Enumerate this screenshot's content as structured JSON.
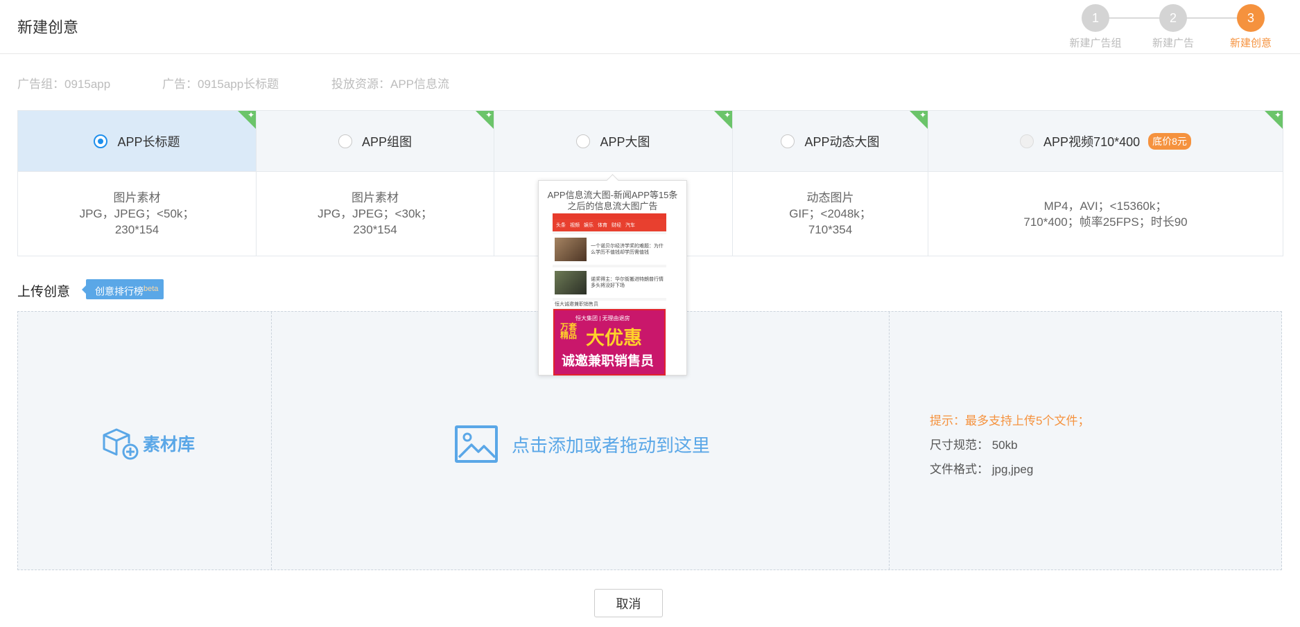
{
  "header": {
    "title": "新建创意",
    "steps": [
      {
        "num": "1",
        "label": "新建广告组"
      },
      {
        "num": "2",
        "label": "新建广告"
      },
      {
        "num": "3",
        "label": "新建创意"
      }
    ],
    "active_step": 3,
    "accent_color": "#f5923e"
  },
  "info": {
    "ad_group": "广告组：0915app",
    "ad": "广告：0915app长标题",
    "resource": "投放资源：APP信息流"
  },
  "types": [
    {
      "label": "APP长标题",
      "selected": true,
      "spec": [
        "图片素材",
        "JPG，JPEG；<50k；",
        "230*154"
      ]
    },
    {
      "label": "APP组图",
      "selected": false,
      "spec": [
        "图片素材",
        "JPG，JPEG；<30k；",
        "230*154"
      ]
    },
    {
      "label": "APP大图",
      "selected": false,
      "spec": []
    },
    {
      "label": "APP动态大图",
      "selected": false,
      "spec": [
        "动态图片",
        "GIF；<2048k；",
        "710*354"
      ]
    },
    {
      "label": "APP视频710*400",
      "selected": false,
      "badge": "底价8元",
      "spec": [
        "MP4，AVI；<15360k；",
        "710*400；帧率25FPS；时长90"
      ]
    }
  ],
  "popup": {
    "title": "APP信息流大图-新闻APP等15条之后的信息流大图广告",
    "nav_items": [
      "头条",
      "视频",
      "娱乐",
      "体育",
      "财经",
      "汽车"
    ],
    "news": [
      "一个诺贝尔经济学奖的难题：为什么学历不值钱却学历需值钱",
      "诺奖得主：华尔街搬进特朗普行情 多头将没好下场"
    ],
    "ad_label": "恒大诚邀兼职销售员",
    "ad_top": "恒大集团 | 无理由退房",
    "ad_small": "万套精品",
    "ad_big": "大优惠",
    "ad_bottom": "诚邀兼职销售员"
  },
  "upload": {
    "section_title": "上传创意",
    "ranking_label": "创意排行榜",
    "ranking_sup": "beta",
    "library_label": "素材库",
    "drop_label": "点击添加或者拖动到这里",
    "tip_warning": "提示：最多支持上传5个文件；",
    "size_spec": "尺寸规范：  50kb",
    "format_spec": "文件格式：  jpg,jpeg"
  },
  "actions": {
    "cancel_label": "取消"
  }
}
